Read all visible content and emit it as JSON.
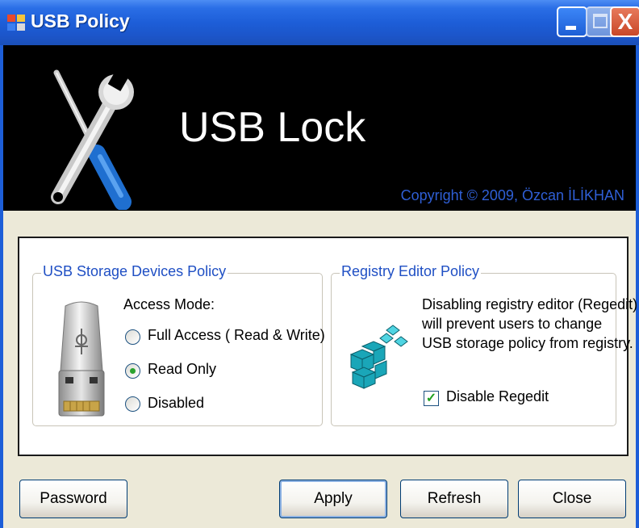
{
  "window": {
    "title": "USB Policy",
    "controls": {
      "minimize": "minimize",
      "maximize": "maximize",
      "close": "X"
    }
  },
  "banner": {
    "title": "USB Lock",
    "copyright": "Copyright © 2009, Özcan İLİKHAN",
    "icon": "tools-icon"
  },
  "usb_group": {
    "title": "USB Storage Devices Policy",
    "access_mode_label": "Access Mode:",
    "options": [
      {
        "label": "Full Access ( Read & Write)",
        "selected": false
      },
      {
        "label": "Read Only",
        "selected": true
      },
      {
        "label": "Disabled",
        "selected": false
      }
    ],
    "icon": "usb-drive-icon"
  },
  "registry_group": {
    "title": "Registry Editor Policy",
    "description_lines": [
      "Disabling registry editor (Regedit)",
      "will prevent users to change",
      "USB storage policy from registry."
    ],
    "checkbox_label": "Disable Regedit",
    "checkbox_checked": true,
    "icon": "regedit-icon"
  },
  "buttons": {
    "password": "Password",
    "apply": "Apply",
    "refresh": "Refresh",
    "close": "Close"
  },
  "colors": {
    "titlebar": "#1d5ed8",
    "accent_text": "#1f4fc4",
    "copyright_text": "#2f5fd6",
    "radio_dot": "#2aa22e"
  }
}
